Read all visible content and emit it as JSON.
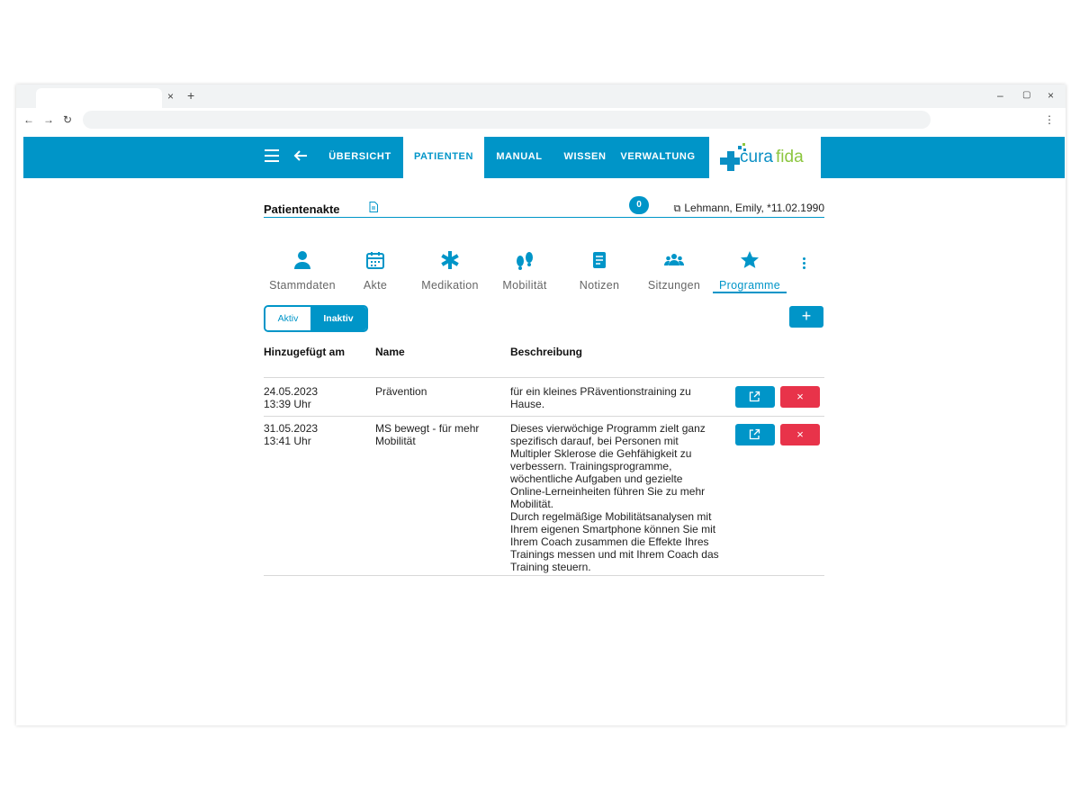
{
  "browser": {
    "tab_close": "×",
    "tab_new": "+",
    "min": "–",
    "restore": "▢",
    "close": "×",
    "back": "←",
    "forward": "→",
    "reload": "↻",
    "menu": "⋮"
  },
  "nav": {
    "items": [
      {
        "label": "ÜBERSICHT"
      },
      {
        "label": "PATIENTEN"
      },
      {
        "label": "MANUAL"
      },
      {
        "label": "WISSEN"
      },
      {
        "label": "VERWALTUNG"
      }
    ],
    "logo_part1": "cura",
    "logo_part2": "fida"
  },
  "header": {
    "title": "Patientenakte",
    "badge_count": "0",
    "patient": "Lehmann, Emily, *11.02.1990"
  },
  "subtabs": [
    {
      "label": "Stammdaten",
      "icon": "person-icon"
    },
    {
      "label": "Akte",
      "icon": "calendar-icon"
    },
    {
      "label": "Medikation",
      "icon": "asterisk-icon"
    },
    {
      "label": "Mobilität",
      "icon": "footprints-icon"
    },
    {
      "label": "Notizen",
      "icon": "note-icon"
    },
    {
      "label": "Sitzungen",
      "icon": "group-icon"
    },
    {
      "label": "Programme",
      "icon": "star-icon"
    }
  ],
  "filter": {
    "aktiv": "Aktiv",
    "inaktiv": "Inaktiv",
    "add": "+"
  },
  "table": {
    "headers": [
      "Hinzugefügt am",
      "Name",
      "Beschreibung"
    ],
    "rows": [
      {
        "date": "24.05.2023",
        "time": "13:39 Uhr",
        "name": "Prävention",
        "desc": "für ein kleines PRäventionstraining zu Hause."
      },
      {
        "date": "31.05.2023",
        "time": "13:41 Uhr",
        "name": "MS bewegt - für mehr Mobilität",
        "desc": "Dieses vierwöchige Programm zielt ganz spezifisch darauf, bei Personen mit Multipler Sklerose die Gehfähigkeit zu verbessern. Trainingsprogramme, wöchentliche Aufgaben und gezielte Online-Lerneinheiten führen Sie zu mehr Mobilität.",
        "desc2": "Durch regelmäßige Mobilitätsanalysen mit Ihrem eigenen Smartphone können Sie mit Ihrem Coach zusammen die Effekte Ihres Trainings messen und mit Ihrem Coach das Training steuern."
      }
    ],
    "delete_label": "×"
  },
  "colors": {
    "primary": "#0095c8",
    "danger": "#e8334a",
    "logo_green": "#8cc63f"
  }
}
